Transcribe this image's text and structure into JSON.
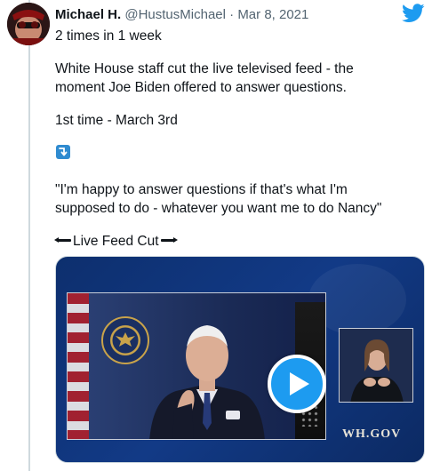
{
  "tweet": {
    "display_name": "Michael H.",
    "handle": "@HustusMichael",
    "separator": "·",
    "date": "Mar 8, 2021",
    "lines": [
      "2 times in 1 week",
      "White House staff cut the live televised feed - the",
      "moment Joe Biden offered to answer questions.",
      "1st time - March 3rd",
      "\"I'm happy to answer questions if that's what I'm",
      "supposed to do - whatever you want me to do Nancy\"",
      "Live Feed Cut"
    ],
    "emoji_icon": "arrow-down-emoji-icon"
  },
  "media": {
    "watermark": "WH.GOV"
  },
  "icons": {
    "brand": "twitter-bird-icon",
    "play": "play-icon"
  },
  "colors": {
    "twitter_blue": "#1d9bf0",
    "text_primary": "#0f1419",
    "text_secondary": "#536471",
    "thread_line": "#cfd9de",
    "media_blue": "#123a86"
  }
}
